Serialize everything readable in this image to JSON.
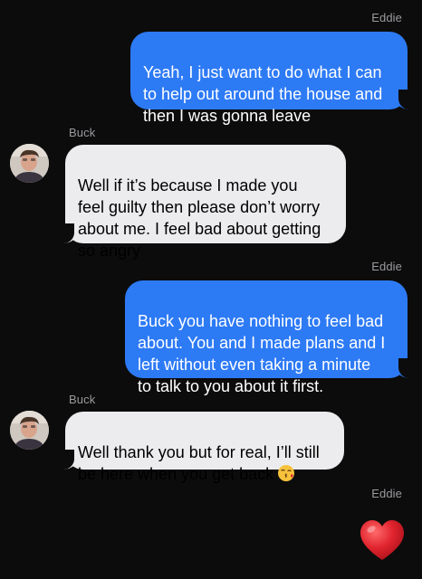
{
  "thread": {
    "messages": [
      {
        "sender": "Eddie",
        "direction": "outgoing",
        "text": "Yeah, I just want to do what I can\nto help out around the house and\nthen I was gonna leave"
      },
      {
        "sender": "Buck",
        "direction": "incoming",
        "text": "Well if it’s because I made you\nfeel guilty then please don’t worry\nabout me. I feel bad about getting\nso angry"
      },
      {
        "sender": "Eddie",
        "direction": "outgoing",
        "text": "Buck you have nothing to feel bad\nabout. You and I made plans and I\nleft without even taking a minute\nto talk to you about it first."
      },
      {
        "sender": "Buck",
        "direction": "incoming",
        "text": "Well thank you but for real, I’ll still\nbe here when you get back",
        "emoji": "kissing-face-with-heart-emoji"
      },
      {
        "sender": "Eddie",
        "direction": "outgoing",
        "emoji": "red-heart-emoji"
      }
    ]
  },
  "colors": {
    "background": "#0c0c0c",
    "outgoing_bubble": "#2d7af5",
    "incoming_bubble": "#ececee",
    "sender_name": "#9a9a9f",
    "heart": "#e0242e"
  }
}
